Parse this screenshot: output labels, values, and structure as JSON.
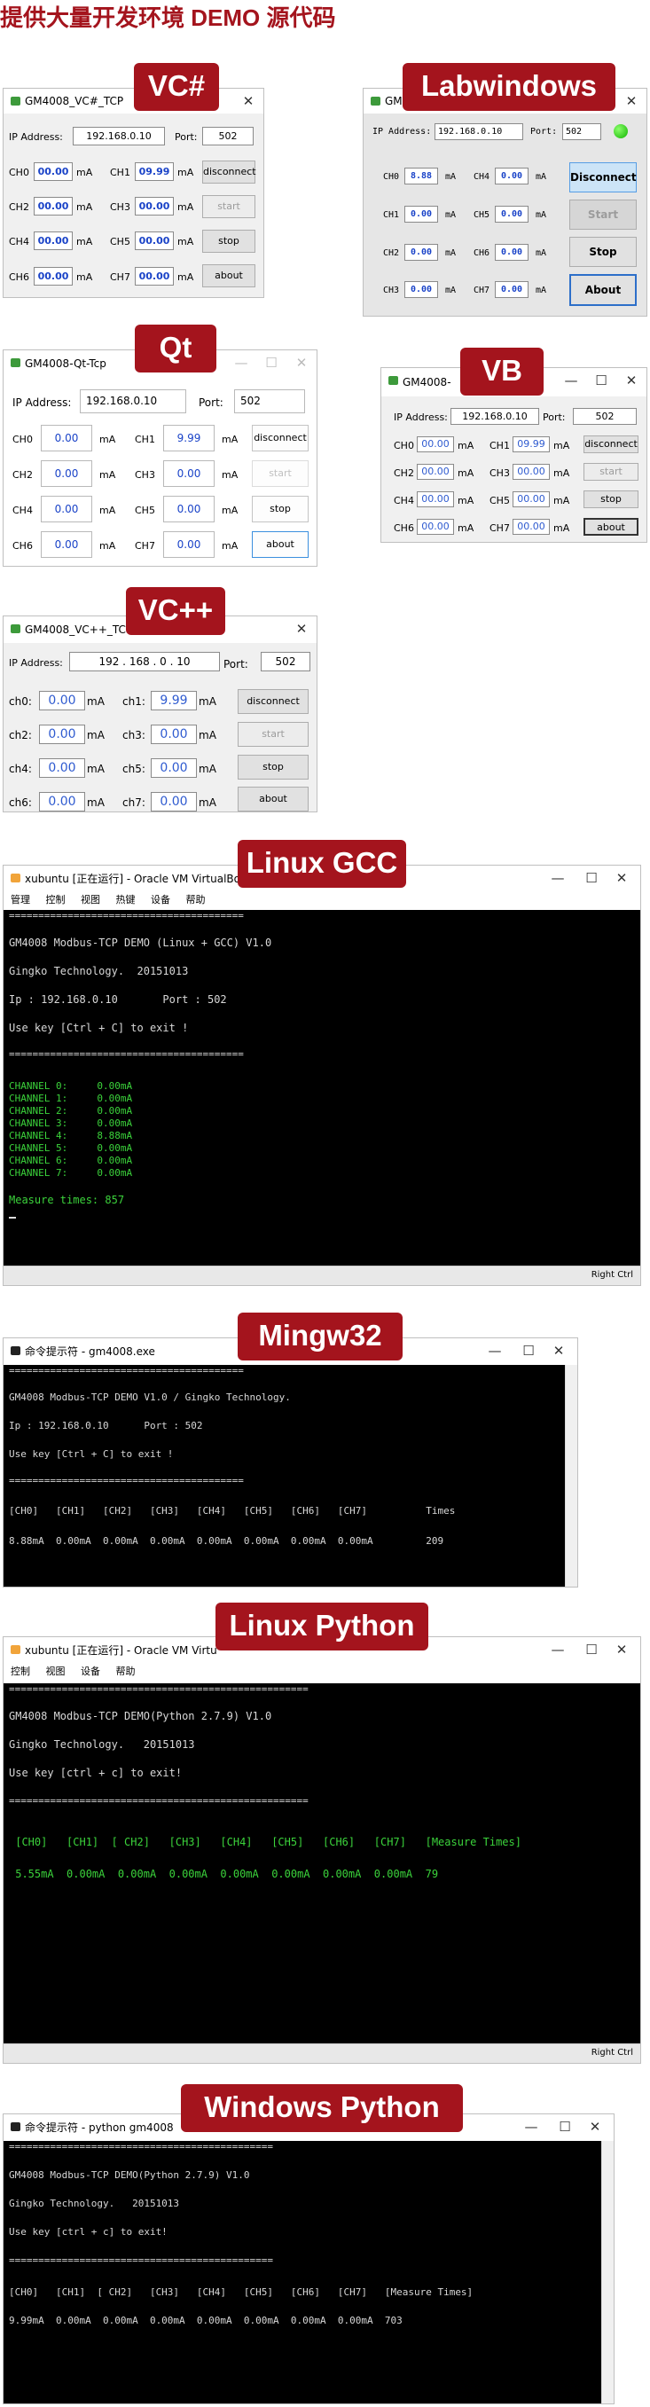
{
  "page_title": "提供大量开发环境 DEMO 源代码",
  "labels": {
    "vcsharp": "VC#",
    "labwindows": "Labwindows",
    "qt": "Qt",
    "vb": "VB",
    "vcpp": "VC++",
    "linux_gcc": "Linux GCC",
    "mingw32": "Mingw32",
    "linux_python": "Linux Python",
    "windows_python": "Windows Python"
  },
  "common": {
    "ip_label": "IP Address:",
    "port_label": "Port:",
    "ip": "192.168.0.10",
    "port": "502",
    "unit": "mA",
    "zero": "00.00",
    "zero_lw": "0.00",
    "lw_ch0": "8.88",
    "lw_ch1": "0.00",
    "ch0": "CH0",
    "ch1": "CH1",
    "ch2": "CH2",
    "ch3": "CH3",
    "ch4": "CH4",
    "ch5": "CH5",
    "ch6": "CH6",
    "ch7": "CH7",
    "lch0": "ch0:",
    "lch1": "ch1:",
    "lch2": "ch2:",
    "lch3": "ch3:",
    "lch4": "ch4:",
    "lch5": "ch5:",
    "lch6": "ch6:",
    "lch7": "ch7:",
    "disconnect": "disconnect",
    "Disconnect": "Disconnect",
    "start": "start",
    "Start": "Start",
    "stop": "stop",
    "Stop": "Stop",
    "about": "about",
    "About": "About"
  },
  "vcsharp": {
    "title": "GM4008_VC#_TCP",
    "ch1": "09.99"
  },
  "labwindows": {
    "title": "GM"
  },
  "qt": {
    "title": "GM4008-Qt-Tcp",
    "ch0": "0.00",
    "ch1": "9.99",
    "zero": "0.00",
    "close": "✕",
    "min": "—",
    "max": "☐"
  },
  "vb": {
    "title": "GM4008-",
    "ch1": "09.99"
  },
  "vcpp": {
    "title": "GM4008_VC++_TC",
    "ip_a": "192",
    "ip_b": "168",
    "ip_c": "0",
    "ip_d": "10",
    "ch1": "9.99",
    "zero": "0.00"
  },
  "linux_gcc": {
    "title": "xubuntu [正在运行] - Oracle VM VirtualBo",
    "menu": [
      "管理",
      "控制",
      "视图",
      "热键",
      "设备",
      "帮助"
    ],
    "lines": [
      "========================================",
      "GM4008 Modbus-TCP DEMO (Linux + GCC) V1.0",
      "Gingko Technology.  20151013",
      "Ip : 192.168.0.10       Port : 502",
      "Use key [Ctrl + C] to exit !",
      "========================================"
    ],
    "channels": [
      "CHANNEL 0:     0.00mA",
      "CHANNEL 1:     0.00mA",
      "CHANNEL 2:     0.00mA",
      "CHANNEL 3:     0.00mA",
      "CHANNEL 4:     8.88mA",
      "CHANNEL 5:     0.00mA",
      "CHANNEL 6:     0.00mA",
      "CHANNEL 7:     0.00mA"
    ],
    "measure": "Measure times: 857",
    "status_key": "Right Ctrl"
  },
  "mingw32": {
    "title": "命令提示符 - gm4008.exe",
    "lines": [
      "========================================",
      "GM4008 Modbus-TCP DEMO V1.0 / Gingko Technology.",
      "Ip : 192.168.0.10      Port : 502",
      "Use key [Ctrl + C] to exit !",
      "========================================",
      "[CH0]   [CH1]   [CH2]   [CH3]   [CH4]   [CH5]   [CH6]   [CH7]          Times",
      "8.88mA  0.00mA  0.00mA  0.00mA  0.00mA  0.00mA  0.00mA  0.00mA         209"
    ]
  },
  "linux_python": {
    "title": "xubuntu [正在运行] - Oracle VM Virtu",
    "menu": [
      "控制",
      "视图",
      "设备",
      "帮助"
    ],
    "lines": [
      "===================================================",
      "GM4008 Modbus-TCP DEMO(Python 2.7.9) V1.0",
      "Gingko Technology.   20151013",
      "Use key [ctrl + c] to exit!",
      "==================================================="
    ],
    "header": " [CH0]   [CH1]  [ CH2]   [CH3]   [CH4]   [CH5]   [CH6]   [CH7]   [Measure Times]",
    "values": " 5.55mA  0.00mA  0.00mA  0.00mA  0.00mA  0.00mA  0.00mA  0.00mA  79",
    "status_key": "Right Ctrl"
  },
  "windows_python": {
    "title": "命令提示符 - python  gm4008",
    "lines": [
      "=============================================",
      "GM4008 Modbus-TCP DEMO(Python 2.7.9) V1.0",
      "Gingko Technology.   20151013",
      "Use key [ctrl + c] to exit!",
      "=============================================",
      "[CH0]   [CH1]  [ CH2]   [CH3]   [CH4]   [CH5]   [CH6]   [CH7]   [Measure Times]",
      "9.99mA  0.00mA  0.00mA  0.00mA  0.00mA  0.00mA  0.00mA  0.00mA  703"
    ]
  },
  "window_controls": {
    "min": "—",
    "max": "☐",
    "close": "✕"
  }
}
